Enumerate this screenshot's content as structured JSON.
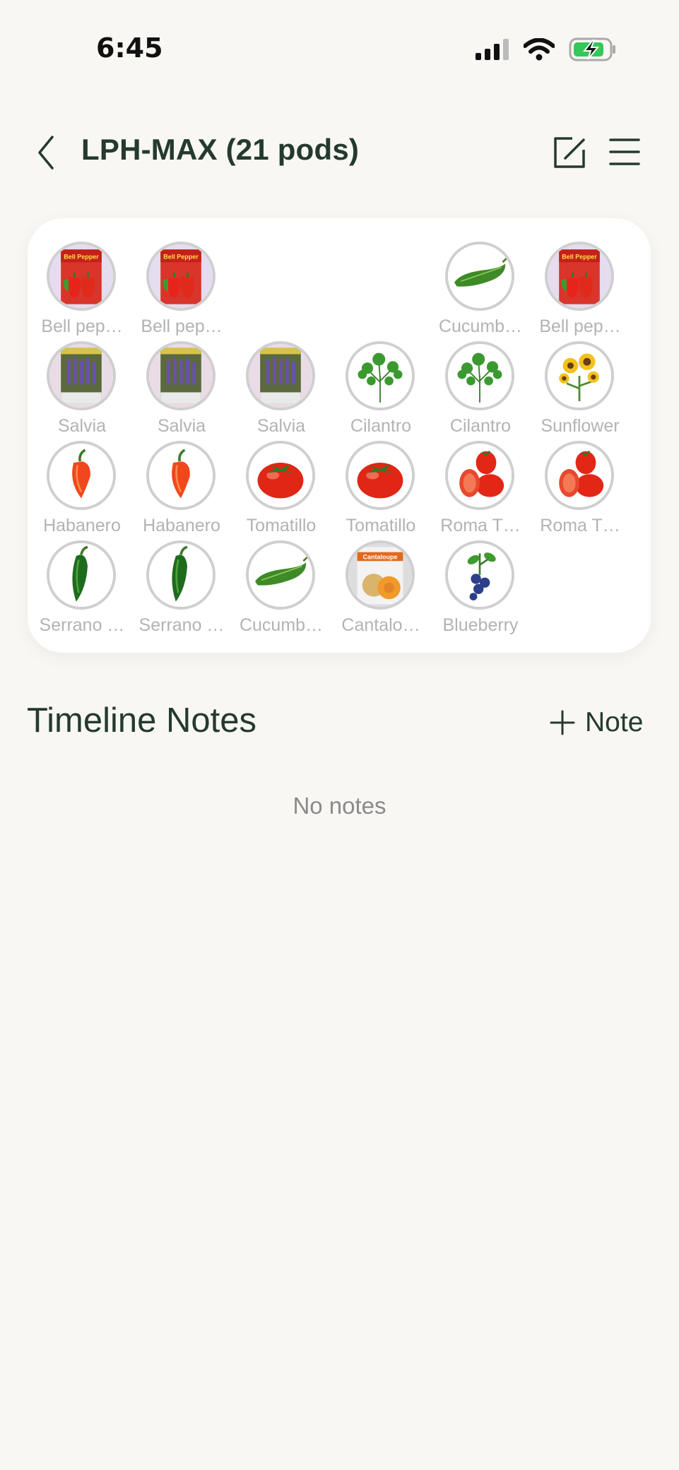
{
  "status": {
    "time": "6:45"
  },
  "header": {
    "title": "LPH-MAX (21 pods)"
  },
  "pods": [
    {
      "label": "Bell pep…",
      "icon": "bell-pepper-packet"
    },
    {
      "label": "Bell pep…",
      "icon": "bell-pepper-packet"
    },
    {
      "label": "Cucumb…",
      "icon": "cucumber"
    },
    {
      "label": "Bell pep…",
      "icon": "bell-pepper-packet"
    },
    {
      "label": "Salvia",
      "icon": "salvia-packet"
    },
    {
      "label": "Salvia",
      "icon": "salvia-packet"
    },
    {
      "label": "Salvia",
      "icon": "salvia-packet"
    },
    {
      "label": "Cilantro",
      "icon": "cilantro"
    },
    {
      "label": "Cilantro",
      "icon": "cilantro"
    },
    {
      "label": "Sunflower",
      "icon": "sunflower"
    },
    {
      "label": "Habanero",
      "icon": "habanero"
    },
    {
      "label": "Habanero",
      "icon": "habanero"
    },
    {
      "label": "Tomatillo",
      "icon": "tomato"
    },
    {
      "label": "Tomatillo",
      "icon": "tomato"
    },
    {
      "label": "Roma T…",
      "icon": "roma-tomato"
    },
    {
      "label": "Roma T…",
      "icon": "roma-tomato"
    },
    {
      "label": "Serrano …",
      "icon": "serrano-pepper"
    },
    {
      "label": "Serrano …",
      "icon": "serrano-pepper"
    },
    {
      "label": "Cucumb…",
      "icon": "cucumber"
    },
    {
      "label": "Cantalo…",
      "icon": "cantaloupe-packet"
    },
    {
      "label": "Blueberry",
      "icon": "blueberry"
    }
  ],
  "packet_text": {
    "bell": "Bell Pepper",
    "cantaloupe": "Cantaloupe"
  },
  "notes": {
    "title": "Timeline Notes",
    "add_label": "Note",
    "empty": "No notes"
  },
  "colors": {
    "accent": "#253a2e",
    "background": "#f8f7f3"
  }
}
